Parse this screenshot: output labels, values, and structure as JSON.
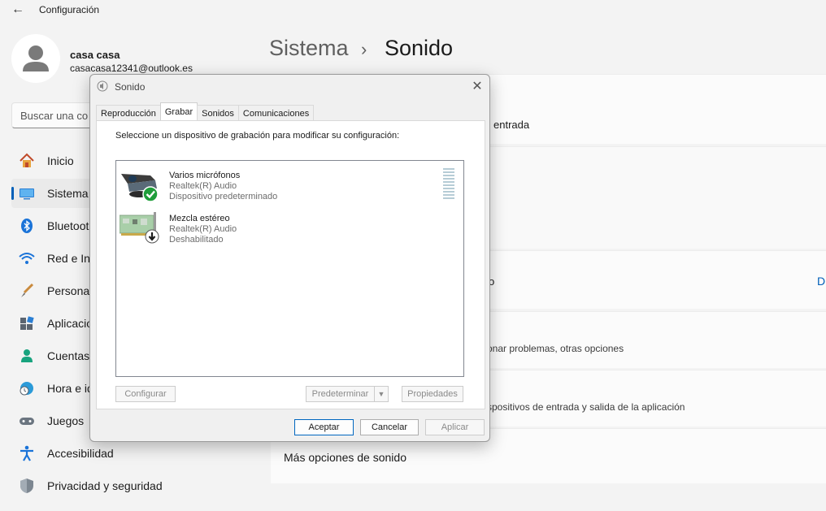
{
  "window": {
    "title": "Configuración",
    "back_icon": "back-arrow-icon"
  },
  "profile": {
    "name": "casa casa",
    "email": "casacasa12341@outlook.es"
  },
  "search": {
    "placeholder": "Buscar una co"
  },
  "nav": {
    "items": [
      {
        "label": "Inicio",
        "icon": "home-icon"
      },
      {
        "label": "Sistema",
        "icon": "system-icon",
        "active": true
      },
      {
        "label": "Bluetoot",
        "icon": "bluetooth-icon"
      },
      {
        "label": "Red e Int",
        "icon": "network-icon"
      },
      {
        "label": "Personal",
        "icon": "personalization-icon"
      },
      {
        "label": "Aplicacio",
        "icon": "apps-icon"
      },
      {
        "label": "Cuentas",
        "icon": "accounts-icon"
      },
      {
        "label": "Hora e id",
        "icon": "time-language-icon"
      },
      {
        "label": "Juegos",
        "icon": "gaming-icon"
      },
      {
        "label": "Accesibilidad",
        "icon": "accessibility-icon"
      },
      {
        "label": "Privacidad y seguridad",
        "icon": "privacy-shield-icon"
      }
    ]
  },
  "breadcrumb": {
    "parent": "Sistema",
    "separator": "›",
    "current": "Sonido"
  },
  "cards": {
    "input_fragment": "entrada",
    "default_fragment": "o",
    "right_cut": "D",
    "troubleshoot_fragment": "onar problemas, otras opciones",
    "app_devices_fragment": "spositivos de entrada y salida de la aplicación",
    "more_sound": "Más opciones de sonido"
  },
  "dialog": {
    "title": "Sonido",
    "close_icon": "close-icon",
    "tabs": [
      "Reproducción",
      "Grabar",
      "Sonidos",
      "Comunicaciones"
    ],
    "active_tab": "Grabar",
    "instructions": "Seleccione un dispositivo de grabación para modificar su configuración:",
    "devices": [
      {
        "name": "Varios micrófonos",
        "driver": "Realtek(R) Audio",
        "status": "Dispositivo predeterminado",
        "icon": "microphone-device-icon",
        "badge": "default-check-icon"
      },
      {
        "name": "Mezcla estéreo",
        "driver": "Realtek(R) Audio",
        "status": "Deshabilitado",
        "icon": "sound-card-icon",
        "badge": "disabled-arrow-icon"
      }
    ],
    "buttons": {
      "configure": "Configurar",
      "set_default": "Predeterminar",
      "properties": "Propiedades",
      "accept": "Aceptar",
      "cancel": "Cancelar",
      "apply": "Aplicar"
    }
  },
  "colors": {
    "accent": "#005fb8",
    "background": "#f3f3f3",
    "card": "#fbfbfb",
    "dialog": "#f0f0f0",
    "check": "#1f9d3a"
  }
}
